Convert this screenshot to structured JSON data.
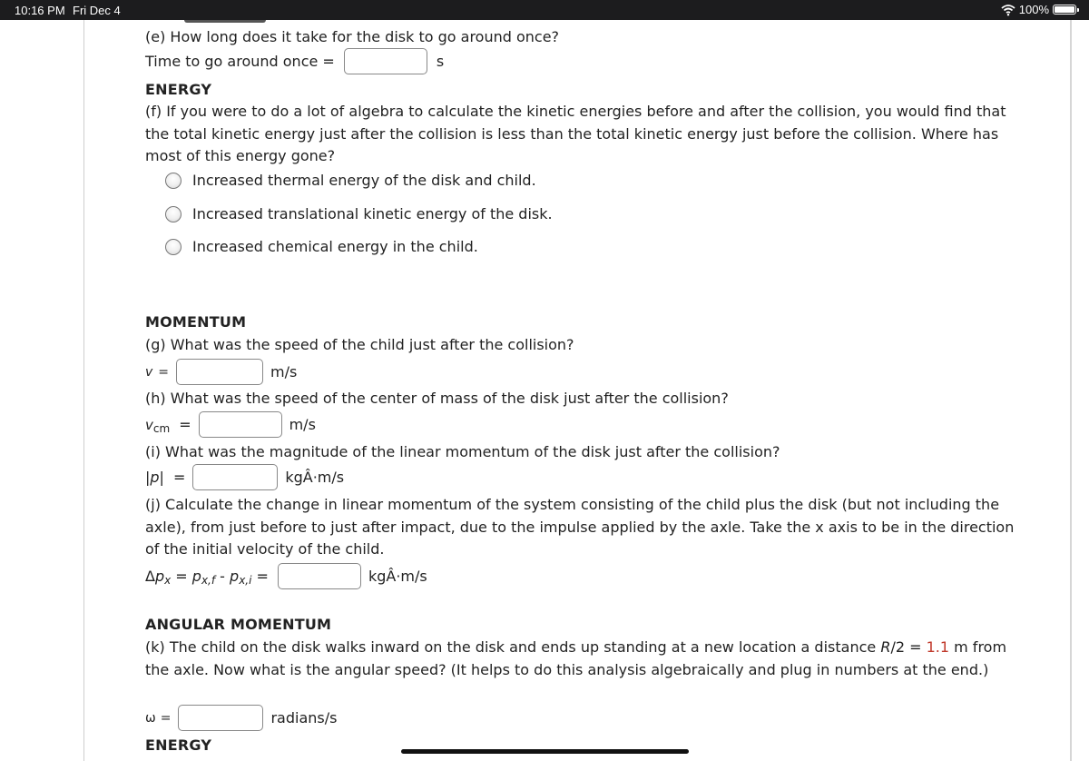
{
  "status_bar": {
    "time": "10:16 PM",
    "date": "Fri Dec 4",
    "battery_label": "100%",
    "wifi_icon": "wifi-icon",
    "battery_icon": "battery-icon"
  },
  "part_e": {
    "question": "(e) How long does it take for the disk to go around once?",
    "label": "Time to go around once =",
    "value": "",
    "unit": "s"
  },
  "energy_section": {
    "heading": "ENERGY",
    "question": "(f) If you were to do a lot of algebra to calculate the kinetic energies before and after the collision, you would find that the total kinetic energy just after the collision is less than the total kinetic energy just before the collision. Where has most of this energy gone?",
    "options": [
      {
        "label": "Increased thermal energy of the disk and child.",
        "selected": false
      },
      {
        "label": "Increased translational kinetic energy of the disk.",
        "selected": false
      },
      {
        "label": "Increased chemical energy in the child.",
        "selected": false
      }
    ]
  },
  "momentum_section": {
    "heading": "MOMENTUM",
    "part_g": {
      "question": "(g) What was the speed of the child just after the collision?",
      "var": "v",
      "eq": "=",
      "value": "",
      "unit": "m/s"
    },
    "part_h": {
      "question": "(h) What was the speed of the center of mass of the disk just after the collision?",
      "var": "v",
      "sub": "cm",
      "eq": "=",
      "value": "",
      "unit": "m/s"
    },
    "part_i": {
      "question": "(i) What was the magnitude of the linear momentum of the disk just after the collision?",
      "var": "|p|",
      "eq": "=",
      "value": "",
      "unit": "kgÂ·m/s"
    },
    "part_j": {
      "question": "(j) Calculate the change in linear momentum of the system consisting of the child plus the disk (but not including the axle), from just before to just after impact, due to the impulse applied by the axle. Take the x axis to be in the direction of the initial velocity of the child.",
      "delta": "Δ",
      "p": "p",
      "sub_x": "x",
      "mid": " = ",
      "sub_xf": "x,f",
      "minus": " - ",
      "sub_xi": "x,i",
      "eq": " =",
      "value": "",
      "unit": "kgÂ·m/s"
    }
  },
  "angular_section": {
    "heading": "ANGULAR MOMENTUM",
    "part_k": {
      "question_pre": "(k) The child on the disk walks inward on the disk and ends up standing at a new location a distance ",
      "r_var": "R",
      "r_rest": "/2 = ",
      "r_value": "1.1",
      "question_post": " m from the axle. Now what is the angular speed? (It helps to do this analysis algebraically and plug in numbers at the end.)",
      "var": "ω",
      "eq": "=",
      "value": "",
      "unit": "radians/s"
    }
  },
  "energy_section_2": {
    "heading": "ENERGY"
  },
  "colors": {
    "given_value": "#c0392b",
    "status_bar_bg": "#1c1c1e"
  }
}
